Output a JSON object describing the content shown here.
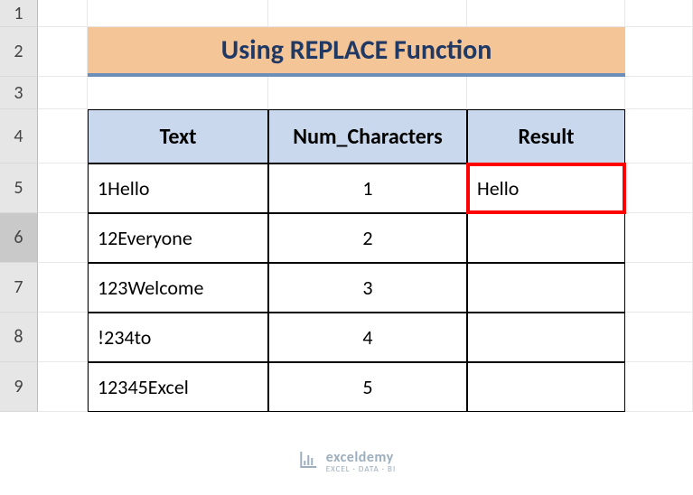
{
  "title": "Using REPLACE Function",
  "rowHeaders": [
    "1",
    "2",
    "3",
    "4",
    "5",
    "6",
    "7",
    "8",
    "9"
  ],
  "selectedRow": "6",
  "table": {
    "headers": {
      "text": "Text",
      "num": "Num_Characters",
      "result": "Result"
    },
    "rows": [
      {
        "text": "1Hello",
        "num": "1",
        "result": "Hello",
        "highlight": true
      },
      {
        "text": "12Everyone",
        "num": "2",
        "result": ""
      },
      {
        "text": "123Welcome",
        "num": "3",
        "result": ""
      },
      {
        "text": "!234to",
        "num": "4",
        "result": ""
      },
      {
        "text": "12345Excel",
        "num": "5",
        "result": ""
      }
    ]
  },
  "watermark": {
    "main": "exceldemy",
    "sub": "EXCEL · DATA · BI"
  },
  "chart_data": {
    "type": "table",
    "title": "Using REPLACE Function",
    "columns": [
      "Text",
      "Num_Characters",
      "Result"
    ],
    "rows": [
      [
        "1Hello",
        1,
        "Hello"
      ],
      [
        "12Everyone",
        2,
        ""
      ],
      [
        "123Welcome",
        3,
        ""
      ],
      [
        "!234to",
        4,
        ""
      ],
      [
        "12345Excel",
        5,
        ""
      ]
    ]
  }
}
